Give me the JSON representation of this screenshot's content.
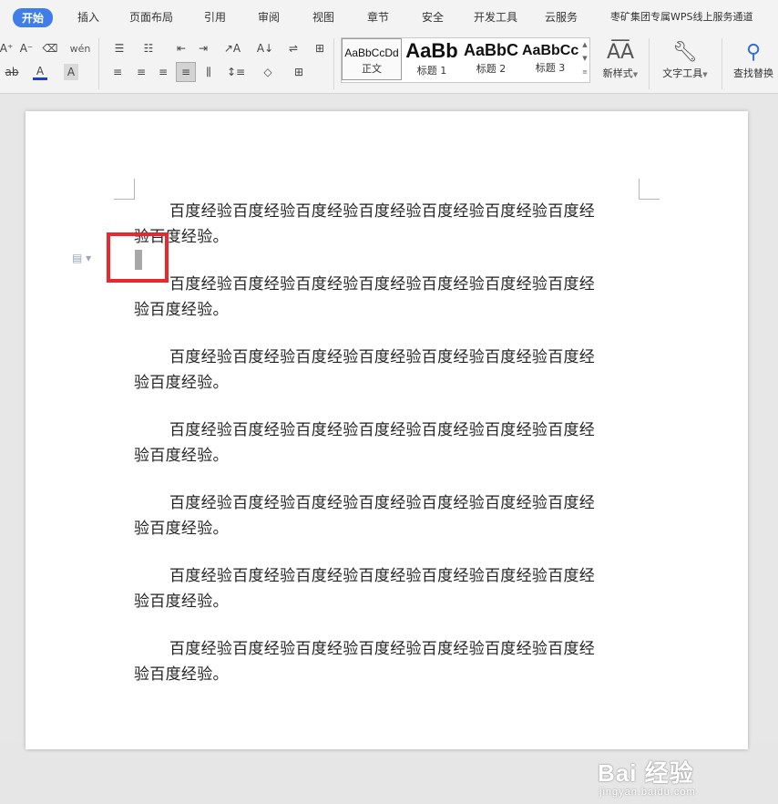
{
  "tabs": [
    "开始",
    "插入",
    "页面布局",
    "引用",
    "审阅",
    "视图",
    "章节",
    "安全",
    "开发工具",
    "云服务",
    "枣矿集团专属WPS线上服务通道"
  ],
  "toolbar": {
    "font_grow": "A⁺",
    "font_shrink": "A⁻",
    "eraser": "⌫",
    "phonetic": "wén",
    "strike": "ab",
    "font_color": "A",
    "char_shade": "A",
    "sort": "A↓",
    "char_border": "A",
    "new_style_label": "新样式",
    "text_tools_label": "文字工具",
    "find_replace_label": "查找替换"
  },
  "styles": [
    {
      "sample": "AaBbCcDd",
      "name": "正文"
    },
    {
      "sample": "AaBb",
      "name": "标题 1"
    },
    {
      "sample": "AaBbC",
      "name": "标题 2"
    },
    {
      "sample": "AaBbCc",
      "name": "标题 3"
    }
  ],
  "document": {
    "paragraphs": [
      {
        "line1": "百度经验百度经验百度经验百度经验百度经验百度经验百度经",
        "line2": "验百度经验。"
      },
      {
        "line1": "百度经验百度经验百度经验百度经验百度经验百度经验百度经",
        "line2": "验百度经验。"
      },
      {
        "line1": "百度经验百度经验百度经验百度经验百度经验百度经验百度经",
        "line2": "验百度经验。"
      },
      {
        "line1": "百度经验百度经验百度经验百度经验百度经验百度经验百度经",
        "line2": "验百度经验。"
      },
      {
        "line1": "百度经验百度经验百度经验百度经验百度经验百度经验百度经",
        "line2": "验百度经验。"
      },
      {
        "line1": "百度经验百度经验百度经验百度经验百度经验百度经验百度经",
        "line2": "验百度经验。"
      },
      {
        "line1": "百度经验百度经验百度经验百度经验百度经验百度经验百度经",
        "line2": "验百度经验。"
      }
    ]
  },
  "watermark": {
    "brand": "Bai 经验",
    "url": "jingyan.baidu.com"
  },
  "colors": {
    "active_tab": "#3f7ee8",
    "highlight": "#e8282e",
    "font_color_underline": "#1f3ecf"
  }
}
